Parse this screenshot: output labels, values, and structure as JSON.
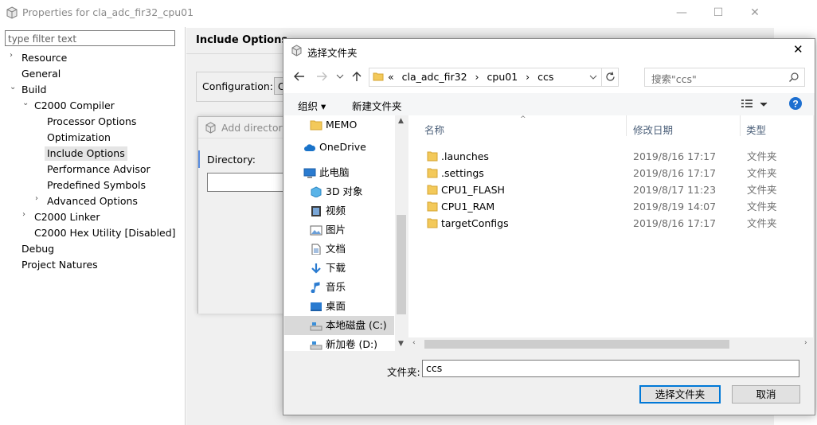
{
  "props_window": {
    "title": "Properties for cla_adc_fir32_cpu01",
    "filter_placeholder": "type filter text",
    "pane_title": "Include Options",
    "configuration_label": "Configuration:",
    "configuration_value": "C",
    "tree": [
      {
        "label": "Resource",
        "arrow": "›"
      },
      {
        "label": "General",
        "arrow": ""
      },
      {
        "label": "Build",
        "arrow": "⌄"
      },
      {
        "label": "C2000 Compiler",
        "arrow": "⌄"
      },
      {
        "label": "Processor Options",
        "arrow": ""
      },
      {
        "label": "Optimization",
        "arrow": ""
      },
      {
        "label": "Include Options",
        "arrow": ""
      },
      {
        "label": "Performance Advisor",
        "arrow": ""
      },
      {
        "label": "Predefined Symbols",
        "arrow": ""
      },
      {
        "label": "Advanced Options",
        "arrow": "›"
      },
      {
        "label": "C2000 Linker",
        "arrow": "›"
      },
      {
        "label": "C2000 Hex Utility  [Disabled]",
        "arrow": ""
      },
      {
        "label": "Debug",
        "arrow": ""
      },
      {
        "label": "Project Natures",
        "arrow": ""
      }
    ]
  },
  "add_dir_dialog": {
    "title": "Add directory",
    "directory_label": "Directory:"
  },
  "browse_dialog": {
    "title": "选择文件夹",
    "close": "✕",
    "breadcrumb": [
      "«",
      "cla_adc_fir32",
      "›",
      "cpu01",
      "›",
      "ccs"
    ],
    "search_placeholder": "搜索\"ccs\"",
    "organize": "组织 ▾",
    "new_folder": "新建文件夹",
    "nav_items": [
      {
        "label": "MEMO",
        "icon": "folder-icon"
      },
      {
        "label": "OneDrive",
        "icon": "cloud-icon"
      },
      {
        "label": "此电脑",
        "icon": "pc-icon"
      },
      {
        "label": "3D 对象",
        "icon": "cube-icon"
      },
      {
        "label": "视频",
        "icon": "video-icon"
      },
      {
        "label": "图片",
        "icon": "picture-icon"
      },
      {
        "label": "文档",
        "icon": "document-icon"
      },
      {
        "label": "下载",
        "icon": "download-icon"
      },
      {
        "label": "音乐",
        "icon": "music-icon"
      },
      {
        "label": "桌面",
        "icon": "desktop-icon"
      },
      {
        "label": "本地磁盘 (C:)",
        "icon": "disk-icon"
      },
      {
        "label": "新加卷 (D:)",
        "icon": "disk-icon"
      }
    ],
    "columns": {
      "name": "名称",
      "date": "修改日期",
      "type": "类型"
    },
    "rows": [
      {
        "name": ".launches",
        "date": "2019/8/16 17:17",
        "type": "文件夹"
      },
      {
        "name": ".settings",
        "date": "2019/8/16 17:17",
        "type": "文件夹"
      },
      {
        "name": "CPU1_FLASH",
        "date": "2019/8/17 11:23",
        "type": "文件夹"
      },
      {
        "name": "CPU1_RAM",
        "date": "2019/8/19 14:07",
        "type": "文件夹"
      },
      {
        "name": "targetConfigs",
        "date": "2019/8/16 17:17",
        "type": "文件夹"
      }
    ],
    "folder_label": "文件夹:",
    "folder_value": "ccs",
    "select_button": "选择文件夹",
    "cancel_button": "取消"
  }
}
